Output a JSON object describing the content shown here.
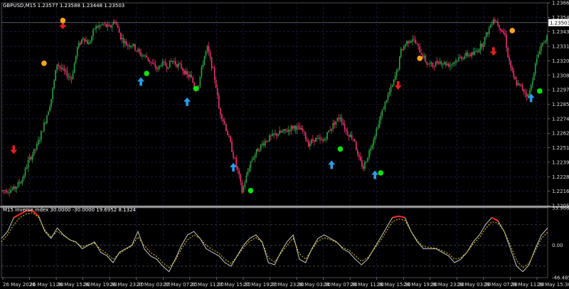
{
  "chart_data": [
    {
      "type": "candlestick",
      "title": "GBPUSD,M15  1.23577 1.23588 1.23448 1.23503",
      "symbol": "GBPUSD",
      "timeframe": "M15",
      "ohlc_header": {
        "open": 1.23577,
        "high": 1.23588,
        "low": 1.23448,
        "close": 1.23503
      },
      "current_price": 1.23503,
      "ylim": [
        1.2205,
        1.2366
      ],
      "y_ticks": [
        "1.23660",
        "1.23545",
        "1.23430",
        "1.23315",
        "1.23200",
        "1.23085",
        "1.22970",
        "1.22855",
        "1.22740",
        "1.22625",
        "1.22510",
        "1.22395",
        "1.22280",
        "1.22165",
        "1.22050"
      ],
      "x_ticks": [
        "26 May 2020",
        "26 May 11:30",
        "26 May 15:30",
        "26 May 19:30",
        "26 May 23:30",
        "27 May 03:30",
        "27 May 07:30",
        "27 May 11:30",
        "27 May 15:30",
        "27 May 19:30",
        "27 May 23:30",
        "28 May 03:30",
        "28 May 07:30",
        "28 May 11:30",
        "28 May 15:30",
        "28 May 19:30",
        "28 May 23:30",
        "29 May 03:30",
        "29 May 07:30",
        "29 May 11:30",
        "29 May 15:30"
      ],
      "bullish_color": "#2ea043",
      "bearish_color": "#e8336d",
      "close_path": [
        [
          0,
          1.2217
        ],
        [
          8,
          1.2218
        ],
        [
          14,
          1.2226
        ],
        [
          18,
          1.224
        ],
        [
          24,
          1.2252
        ],
        [
          30,
          1.2273
        ],
        [
          34,
          1.229
        ],
        [
          38,
          1.2318
        ],
        [
          42,
          1.2312
        ],
        [
          48,
          1.2306
        ],
        [
          52,
          1.233
        ],
        [
          56,
          1.2339
        ],
        [
          60,
          1.2333
        ],
        [
          64,
          1.2346
        ],
        [
          70,
          1.2349
        ],
        [
          74,
          1.2346
        ],
        [
          78,
          1.2352
        ],
        [
          82,
          1.2339
        ],
        [
          86,
          1.2333
        ],
        [
          90,
          1.2333
        ],
        [
          92,
          1.233
        ],
        [
          96,
          1.2325
        ],
        [
          100,
          1.2323
        ],
        [
          104,
          1.2317
        ],
        [
          108,
          1.2313
        ],
        [
          110,
          1.2318
        ],
        [
          114,
          1.2316
        ],
        [
          118,
          1.232
        ],
        [
          120,
          1.2318
        ],
        [
          124,
          1.2315
        ],
        [
          128,
          1.2308
        ],
        [
          130,
          1.2308
        ],
        [
          134,
          1.2298
        ],
        [
          136,
          1.2302
        ],
        [
          140,
          1.2324
        ],
        [
          142,
          1.233
        ],
        [
          146,
          1.2312
        ],
        [
          148,
          1.23
        ],
        [
          150,
          1.2282
        ],
        [
          154,
          1.227
        ],
        [
          158,
          1.2254
        ],
        [
          160,
          1.2245
        ],
        [
          164,
          1.2228
        ],
        [
          166,
          1.2216
        ],
        [
          168,
          1.2224
        ],
        [
          172,
          1.224
        ],
        [
          176,
          1.2248
        ],
        [
          180,
          1.2254
        ],
        [
          184,
          1.2258
        ],
        [
          190,
          1.2262
        ],
        [
          196,
          1.2264
        ],
        [
          202,
          1.2268
        ],
        [
          208,
          1.2264
        ],
        [
          212,
          1.2254
        ],
        [
          216,
          1.2258
        ],
        [
          222,
          1.2256
        ],
        [
          226,
          1.2264
        ],
        [
          230,
          1.2271
        ],
        [
          234,
          1.2276
        ],
        [
          238,
          1.2264
        ],
        [
          244,
          1.2257
        ],
        [
          246,
          1.2244
        ],
        [
          250,
          1.2235
        ],
        [
          254,
          1.2248
        ],
        [
          258,
          1.2262
        ],
        [
          262,
          1.2276
        ],
        [
          266,
          1.229
        ],
        [
          270,
          1.23
        ],
        [
          274,
          1.2315
        ],
        [
          276,
          1.2328
        ],
        [
          280,
          1.2335
        ],
        [
          284,
          1.2338
        ],
        [
          290,
          1.2326
        ],
        [
          294,
          1.2318
        ],
        [
          298,
          1.2316
        ],
        [
          302,
          1.232
        ],
        [
          306,
          1.2318
        ],
        [
          310,
          1.2317
        ],
        [
          316,
          1.2322
        ],
        [
          322,
          1.2325
        ],
        [
          326,
          1.2325
        ],
        [
          332,
          1.2333
        ],
        [
          336,
          1.2343
        ],
        [
          340,
          1.2354
        ],
        [
          344,
          1.2348
        ],
        [
          348,
          1.234
        ],
        [
          350,
          1.2324
        ],
        [
          354,
          1.2306
        ],
        [
          356,
          1.2302
        ],
        [
          360,
          1.2298
        ],
        [
          364,
          1.2292
        ],
        [
          366,
          1.23
        ],
        [
          368,
          1.2312
        ],
        [
          372,
          1.233
        ],
        [
          376,
          1.2338
        ]
      ],
      "buy_signals_blue_arrows": [
        [
          96,
          1.2303
        ],
        [
          128,
          1.2287
        ],
        [
          160,
          1.2235
        ],
        [
          228,
          1.2237
        ],
        [
          258,
          1.2229
        ],
        [
          366,
          1.229
        ]
      ],
      "sell_signals_red_arrows": [
        [
          8,
          1.225
        ],
        [
          42,
          1.2349
        ],
        [
          274,
          1.2301
        ],
        [
          340,
          1.2328
        ]
      ],
      "green_dots": [
        [
          100,
          1.231
        ],
        [
          134,
          1.2298
        ],
        [
          172,
          1.2217
        ],
        [
          234,
          1.225
        ],
        [
          262,
          1.2231
        ],
        [
          372,
          1.2296
        ]
      ],
      "orange_dots": [
        [
          29,
          1.2318
        ],
        [
          42,
          1.2352
        ],
        [
          289,
          1.2322
        ],
        [
          353,
          1.2344
        ]
      ]
    },
    {
      "type": "line",
      "title": "M15 inverse index 30.0000 -30.0000 19.6952 8.1324",
      "ylim": [
        -46.4856,
        53.9686
      ],
      "y_ticks": [
        "53.9686",
        "0.00",
        "-46.4856"
      ],
      "levels": [
        30,
        0,
        -30
      ],
      "series": [
        {
          "name": "19.6952",
          "style": "solid",
          "color": "#c8c8c8",
          "values": [
            10,
            20,
            40,
            45,
            50,
            50,
            42,
            20,
            10,
            25,
            15,
            8,
            5,
            -5,
            0,
            5,
            -10,
            -15,
            -25,
            -10,
            -5,
            0,
            20,
            -5,
            -15,
            -20,
            -30,
            -38,
            -20,
            0,
            15,
            20,
            10,
            -5,
            -10,
            -15,
            -25,
            -30,
            -15,
            0,
            10,
            15,
            5,
            -25,
            -28,
            -10,
            5,
            15,
            -20,
            -25,
            -5,
            10,
            15,
            10,
            5,
            -5,
            -10,
            -20,
            -28,
            -20,
            -5,
            10,
            25,
            40,
            42,
            40,
            20,
            5,
            -5,
            -5,
            -5,
            -10,
            -15,
            -25,
            -20,
            -10,
            5,
            15,
            30,
            40,
            35,
            20,
            -5,
            -30,
            -38,
            -28,
            -5,
            15,
            25
          ]
        },
        {
          "name": "8.1324",
          "style": "dashed",
          "color": "#e8d000",
          "values": [
            5,
            15,
            30,
            40,
            45,
            47,
            40,
            22,
            12,
            20,
            14,
            8,
            4,
            -2,
            1,
            3,
            -6,
            -12,
            -20,
            -12,
            -6,
            -1,
            12,
            0,
            -10,
            -16,
            -25,
            -32,
            -22,
            -5,
            8,
            15,
            10,
            0,
            -6,
            -11,
            -20,
            -26,
            -16,
            -3,
            6,
            11,
            5,
            -18,
            -24,
            -12,
            0,
            10,
            -12,
            -20,
            -6,
            6,
            11,
            8,
            4,
            -3,
            -7,
            -15,
            -23,
            -18,
            -6,
            6,
            20,
            34,
            38,
            36,
            20,
            7,
            -2,
            -3,
            -4,
            -8,
            -12,
            -20,
            -18,
            -10,
            2,
            11,
            24,
            34,
            32,
            20,
            0,
            -22,
            -32,
            -26,
            -8,
            10,
            19
          ]
        }
      ],
      "overbought_color": "#ff2a2a",
      "oversold_color": "#33aaff"
    }
  ]
}
